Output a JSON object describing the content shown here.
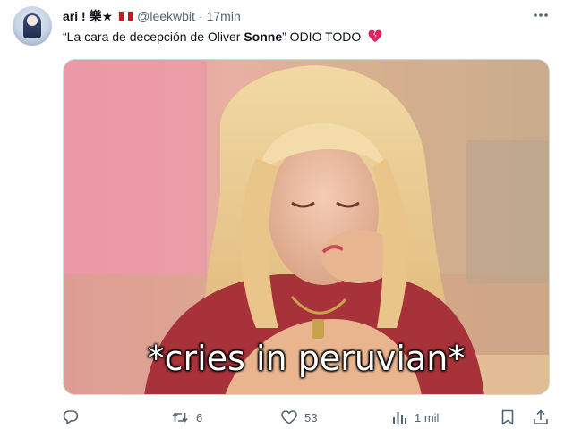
{
  "author": {
    "display_name": "ari ! 樂★",
    "handle": "@leekwbit",
    "separator": "·",
    "time": "17min"
  },
  "tweet": {
    "text_before": "“La cara de decepción de Oliver ",
    "text_bold": "Sonne",
    "text_after": "” ODIO TODO",
    "emoji": "broken-heart-icon"
  },
  "media": {
    "caption": "*cries in peruvian*"
  },
  "actions": {
    "reply_count": "",
    "retweet_count": "6",
    "like_count": "53",
    "views_count": "1 mil"
  },
  "colors": {
    "text_primary": "#0f1419",
    "text_secondary": "#536471",
    "border": "#cfd9de",
    "broken_heart": "#e0245e"
  }
}
